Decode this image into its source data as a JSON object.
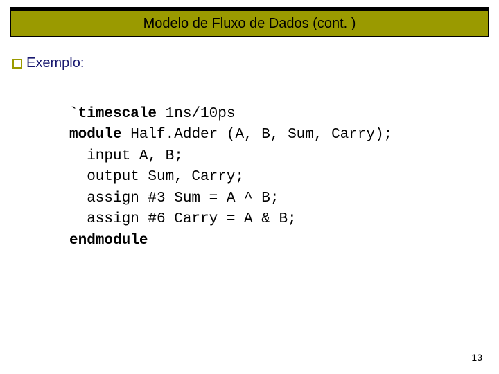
{
  "title": "Modelo de Fluxo de Dados (cont. )",
  "bullet": {
    "label": "Exemplo:"
  },
  "code": {
    "l1a": "`timescale",
    "l1b": " 1ns/10ps",
    "l2a": "module",
    "l2b": " Half.Adder (A, B, Sum, Carry);",
    "l3": "  input A, B;",
    "l4": "  output Sum, Carry;",
    "l5": "  assign #3 Sum = A ^ B;",
    "l6": "  assign #6 Carry = A & B;",
    "l7": "endmodule"
  },
  "page_number": "13"
}
